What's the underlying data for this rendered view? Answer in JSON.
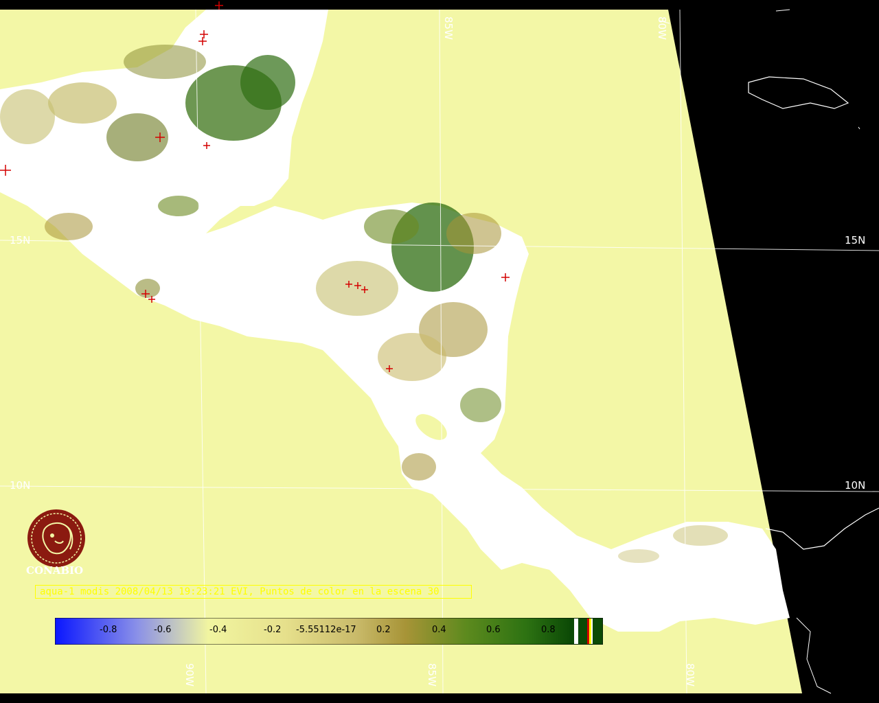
{
  "map": {
    "latitude_labels": {
      "lat15": "15N",
      "lat10": "10N"
    },
    "longitude_labels": {
      "lon85_top": "85W",
      "lon80_top": "80W",
      "lon90_bottom": "90W",
      "lon85_bottom": "85W",
      "lon80_bottom": "80W"
    },
    "colors": {
      "ocean": "#f3f7a6",
      "land_no_data": "#ffffff",
      "vegetation_high": "#2f6e12",
      "vegetation_mid": "#8c8f36",
      "vegetation_low": "#c7bf70",
      "hotspot": "#d40000",
      "background": "#000000"
    }
  },
  "logo": {
    "name": "CONABIO",
    "color": "#8b1a10"
  },
  "caption": {
    "text": "aqua-1 modis 2008/04/13 19:23:21 EVI, Puntos de color en la escena 30",
    "color": "#ffff00"
  },
  "colorbar": {
    "ticks": [
      "-0.8",
      "-0.6",
      "-0.4",
      "-0.2",
      "-5.55112e-17",
      "0.2",
      "0.4",
      "0.6",
      "0.8"
    ],
    "gradient_stops": [
      "#0a16ff",
      "#9aa0e6",
      "#f1f5a0",
      "#e6e08c",
      "#c9ba6a",
      "#a79437",
      "#6c8a22",
      "#2d7212",
      "#0c4a06"
    ]
  }
}
